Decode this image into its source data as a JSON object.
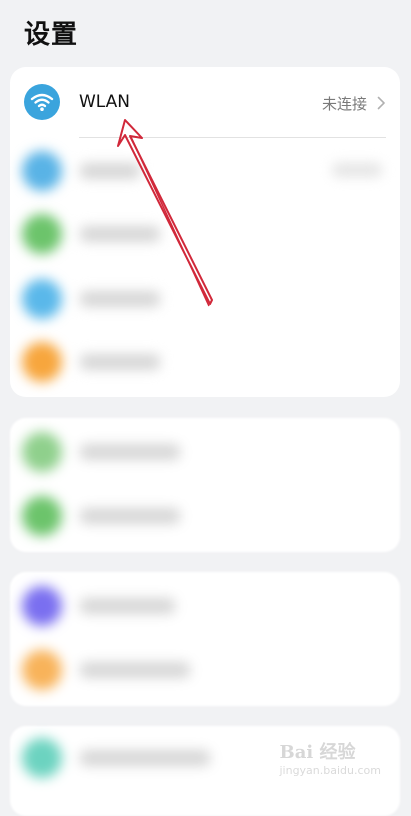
{
  "header": {
    "title": "设置"
  },
  "wlan": {
    "label": "WLAN",
    "status": "未连接",
    "icon": "wifi-icon",
    "icon_color": "#3aa4dd"
  },
  "blurred_rows": {
    "icon_colors": [
      "#59b3e6",
      "#6cc46b",
      "#5ab8ea",
      "#f7a63d",
      "#8fd08c",
      "#6cc46b",
      "#7a6ff0",
      "#f8b35a",
      "#6cd3c0"
    ]
  },
  "watermark": {
    "main": "Bai 经验",
    "sub": "jingyan.baidu.com"
  },
  "annotation": {
    "color": "#d1283a"
  }
}
